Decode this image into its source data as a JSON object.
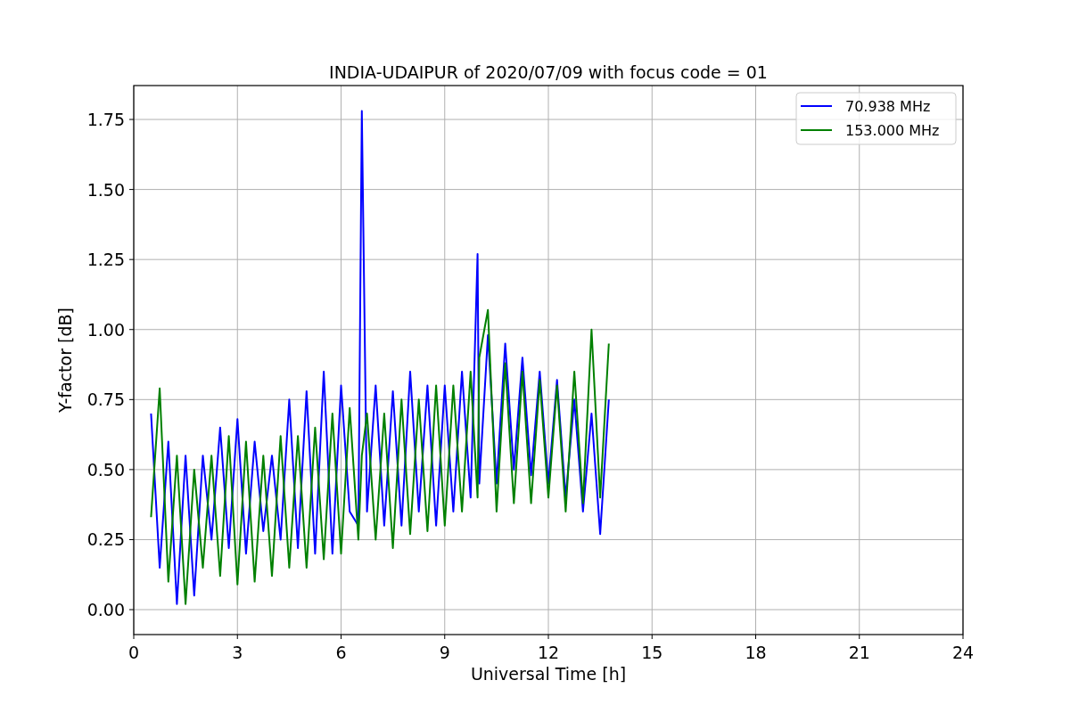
{
  "chart_data": {
    "type": "line",
    "title": "INDIA-UDAIPUR of 2020/07/09 with focus code = 01",
    "xlabel": "Universal Time [h]",
    "ylabel": "Y-factor [dB]",
    "x": [
      0.5,
      0.75,
      1.0,
      1.25,
      1.5,
      1.75,
      2.0,
      2.25,
      2.5,
      2.75,
      3.0,
      3.25,
      3.5,
      3.75,
      4.0,
      4.25,
      4.5,
      4.75,
      5.0,
      5.25,
      5.5,
      5.75,
      6.0,
      6.25,
      6.5,
      6.6,
      6.75,
      7.0,
      7.25,
      7.5,
      7.75,
      8.0,
      8.25,
      8.5,
      8.75,
      9.0,
      9.25,
      9.5,
      9.75,
      9.95,
      10.0,
      10.25,
      10.5,
      10.75,
      11.0,
      11.25,
      11.5,
      11.75,
      12.0,
      12.25,
      12.5,
      12.75,
      13.0,
      13.25,
      13.5,
      13.75
    ],
    "series": [
      {
        "name": "70.938 MHz",
        "color": "#0000ff",
        "values": [
          0.7,
          0.15,
          0.6,
          0.02,
          0.55,
          0.05,
          0.55,
          0.25,
          0.65,
          0.22,
          0.68,
          0.2,
          0.6,
          0.28,
          0.55,
          0.25,
          0.75,
          0.22,
          0.78,
          0.2,
          0.85,
          0.2,
          0.8,
          0.35,
          0.3,
          1.78,
          0.35,
          0.8,
          0.3,
          0.78,
          0.3,
          0.85,
          0.35,
          0.8,
          0.3,
          0.8,
          0.35,
          0.85,
          0.4,
          1.27,
          0.45,
          0.98,
          0.45,
          0.95,
          0.5,
          0.9,
          0.48,
          0.85,
          0.45,
          0.82,
          0.4,
          0.75,
          0.35,
          0.7,
          0.27,
          0.75
        ]
      },
      {
        "name": "153.000 MHz",
        "color": "#008000",
        "values": [
          0.33,
          0.79,
          0.1,
          0.55,
          0.02,
          0.5,
          0.15,
          0.55,
          0.12,
          0.62,
          0.09,
          0.6,
          0.1,
          0.55,
          0.12,
          0.62,
          0.15,
          0.62,
          0.15,
          0.65,
          0.18,
          0.7,
          0.2,
          0.72,
          0.25,
          0.55,
          0.7,
          0.25,
          0.7,
          0.22,
          0.75,
          0.27,
          0.75,
          0.28,
          0.8,
          0.3,
          0.8,
          0.35,
          0.85,
          0.4,
          0.9,
          1.07,
          0.35,
          0.88,
          0.38,
          0.85,
          0.38,
          0.82,
          0.4,
          0.8,
          0.35,
          0.85,
          0.38,
          1.0,
          0.4,
          0.95
        ]
      }
    ],
    "xlim": [
      0,
      24
    ],
    "ylim": [
      -0.089,
      1.871
    ],
    "grid": true,
    "legend": true,
    "xticks": [
      0,
      3,
      6,
      9,
      12,
      15,
      18,
      21,
      24
    ],
    "yticks": [
      {
        "value": 0,
        "label": "0.00"
      },
      {
        "value": 0.25,
        "label": "0.25"
      },
      {
        "value": 0.5,
        "label": "0.50"
      },
      {
        "value": 0.75,
        "label": "0.75"
      },
      {
        "value": 1.0,
        "label": "1.00"
      },
      {
        "value": 1.25,
        "label": "1.25"
      },
      {
        "value": 1.5,
        "label": "1.50"
      },
      {
        "value": 1.75,
        "label": "1.75"
      }
    ]
  }
}
